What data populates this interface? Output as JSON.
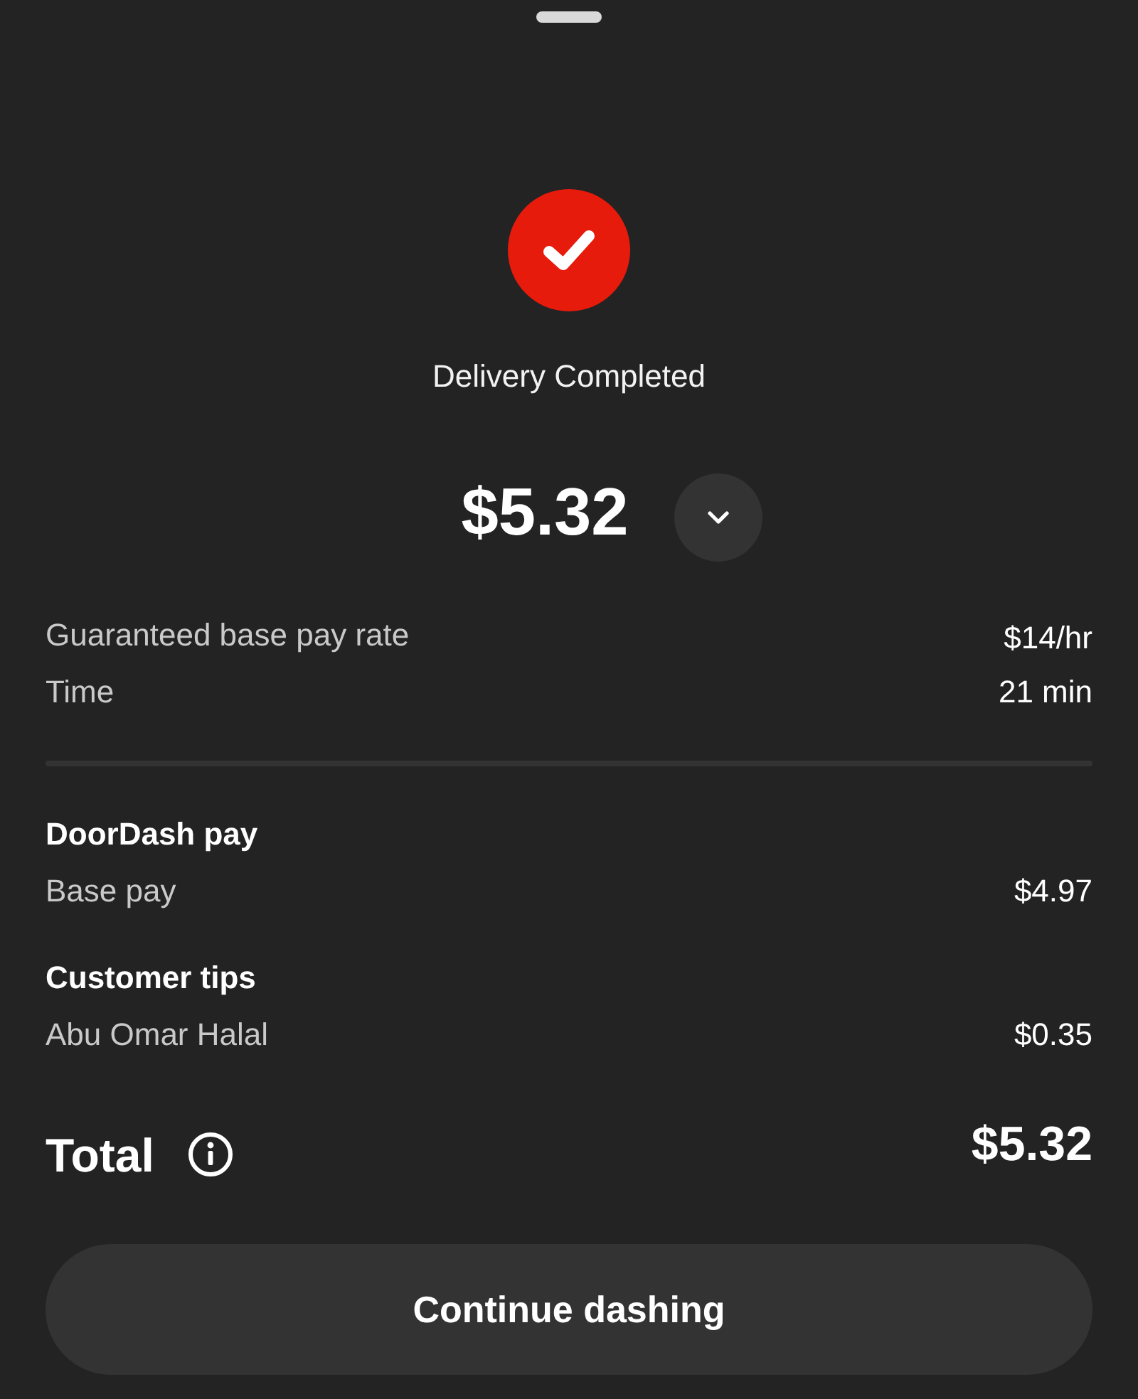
{
  "header": {
    "status": "Delivery Completed",
    "amount": "$5.32",
    "expanded": false
  },
  "summary": [
    {
      "label": "Guaranteed base pay rate",
      "value": "$14/hr"
    },
    {
      "label": "Time",
      "value": "21 min"
    }
  ],
  "sections": [
    {
      "title": "DoorDash pay",
      "items": [
        {
          "label": "Base pay",
          "value": "$4.97"
        }
      ]
    },
    {
      "title": "Customer tips",
      "items": [
        {
          "label": "Abu Omar Halal",
          "value": "$0.35"
        }
      ]
    }
  ],
  "total": {
    "label": "Total",
    "value": "$5.32"
  },
  "button": {
    "label": "Continue dashing"
  }
}
